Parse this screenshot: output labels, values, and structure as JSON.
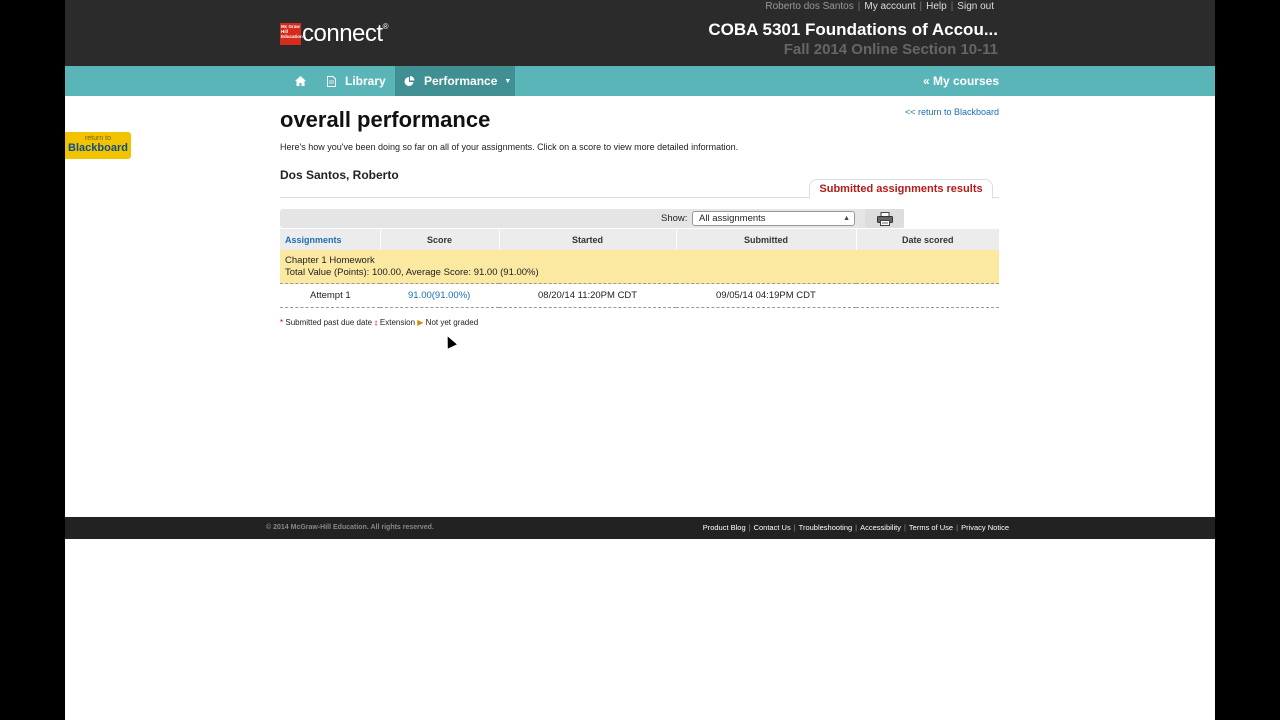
{
  "header": {
    "user_name": "Roberto dos Santos",
    "my_account": "My account",
    "help": "Help",
    "sign_out": "Sign out",
    "logo_badge": "Mc Graw Hill Education",
    "logo_word": "connect",
    "logo_reg": "®",
    "course_title": "COBA 5301 Foundations of Accou...",
    "course_section": "Fall 2014 Online Section 10-11"
  },
  "nav": {
    "home_icon": "home-icon",
    "library_label": "Library",
    "performance_label": "Performance",
    "my_courses_label": "« My courses"
  },
  "bb_tab": {
    "line1": "return to",
    "line2": "Blackboard"
  },
  "main": {
    "title": "overall performance",
    "return_link": "<< return to Blackboard",
    "intro": "Here's how you've been doing so far on all of your assignments. Click on a score to view more detailed information.",
    "student_name": "Dos Santos, Roberto",
    "results_tab": "Submitted assignments results",
    "show_label": "Show:",
    "show_value": "All assignments",
    "columns": [
      "Assignments",
      "Score",
      "Started",
      "Submitted",
      "Date scored"
    ],
    "group": {
      "name": "Chapter 1 Homework",
      "summary": "Total Value (Points): 100.00, Average Score: 91.00 (91.00%)"
    },
    "attempt": {
      "label": "Attempt 1",
      "score": "91.00(91.00%)",
      "started": "08/20/14 11:20PM CDT",
      "submitted": "09/05/14 04:19PM CDT",
      "date_scored": ""
    },
    "legend": {
      "past_due": "Submitted past due date",
      "extension": "Extension",
      "not_graded": "Not yet graded"
    }
  },
  "footer": {
    "copyright": "© 2014 McGraw-Hill Education. All rights reserved.",
    "links": [
      "Product Blog",
      "Contact Us",
      "Troubleshooting",
      "Accessibility",
      "Terms of Use",
      "Privacy Notice"
    ]
  },
  "colors": {
    "teal_nav": "#5ab5b8",
    "active_nav": "#3f8f93",
    "group_highlight": "#fbe9a2",
    "link_blue": "#1a6fb5",
    "tab_red": "#b51a1a"
  }
}
